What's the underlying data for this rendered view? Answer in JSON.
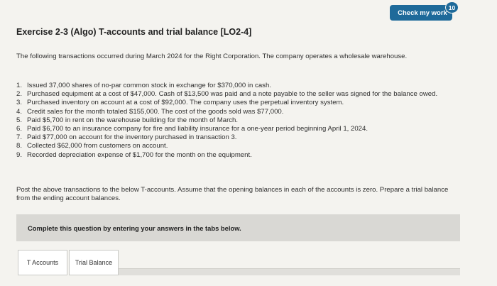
{
  "check_button": {
    "label": "Check my work",
    "badge": "10"
  },
  "exercise": {
    "title": "Exercise 2-3 (Algo) T-accounts and trial balance [LO2-4]"
  },
  "intro": "The following transactions occurred during March 2024 for the Right Corporation. The company operates a wholesale warehouse.",
  "transactions": [
    {
      "num": "1.",
      "text": "Issued 37,000 shares of no-par common stock in exchange for $370,000 in cash."
    },
    {
      "num": "2.",
      "text": "Purchased equipment at a cost of $47,000. Cash of $13,500 was paid and a note payable to the seller was signed for the balance owed."
    },
    {
      "num": "3.",
      "text": "Purchased inventory on account at a cost of $92,000. The company uses the perpetual inventory system."
    },
    {
      "num": "4.",
      "text": "Credit sales for the month totaled $155,000. The cost of the goods sold was $77,000."
    },
    {
      "num": "5.",
      "text": "Paid $5,700 in rent on the warehouse building for the month of March."
    },
    {
      "num": "6.",
      "text": "Paid $6,700 to an insurance company for fire and liability insurance for a one-year period beginning April 1, 2024."
    },
    {
      "num": "7.",
      "text": "Paid $77,000 on account for the inventory purchased in transaction 3."
    },
    {
      "num": "8.",
      "text": "Collected $62,000 from customers on account."
    },
    {
      "num": "9.",
      "text": "Recorded depreciation expense of $1,700 for the month on the equipment."
    }
  ],
  "instructions": "Post the above transactions to the below T-accounts. Assume that the opening balances in each of the accounts is zero. Prepare a trial balance from the ending account balances.",
  "panel": {
    "text": "Complete this question by entering your answers in the tabs below."
  },
  "tabs": [
    {
      "label": "T Accounts"
    },
    {
      "label": "Trial Balance"
    }
  ]
}
